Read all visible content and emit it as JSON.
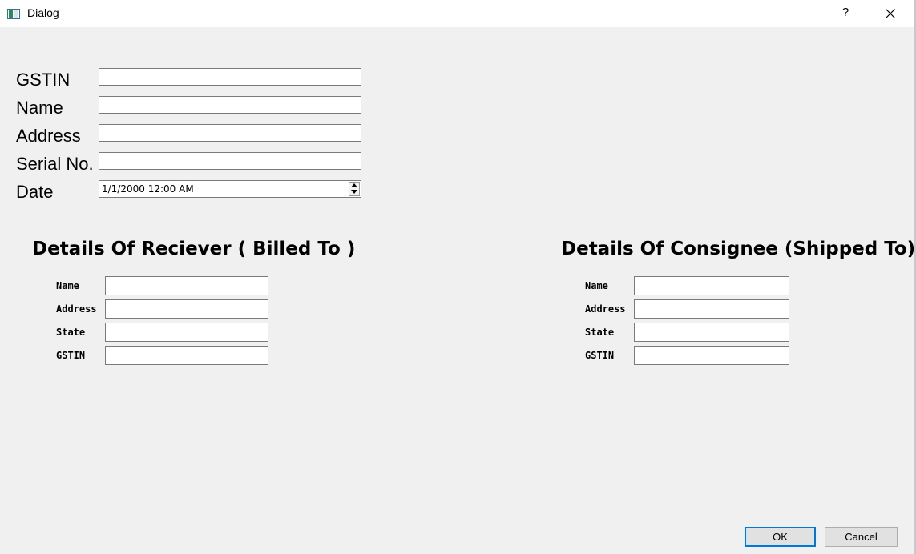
{
  "window": {
    "title": "Dialog",
    "help_label": "?"
  },
  "main_form": {
    "fields": [
      {
        "label": "GSTIN",
        "value": ""
      },
      {
        "label": "Name",
        "value": ""
      },
      {
        "label": "Address",
        "value": ""
      },
      {
        "label": "Serial No.",
        "value": ""
      }
    ],
    "date": {
      "label": "Date",
      "value": "1/1/2000 12:00 AM"
    }
  },
  "receiver": {
    "heading": "Details Of Reciever ( Billed To )",
    "fields": [
      {
        "label": "Name",
        "value": ""
      },
      {
        "label": "Address",
        "value": ""
      },
      {
        "label": "State",
        "value": ""
      },
      {
        "label": "GSTIN",
        "value": ""
      }
    ]
  },
  "consignee": {
    "heading": "Details Of Consignee (Shipped To)",
    "fields": [
      {
        "label": "Name",
        "value": ""
      },
      {
        "label": "Address",
        "value": ""
      },
      {
        "label": "State",
        "value": ""
      },
      {
        "label": "GSTIN",
        "value": ""
      }
    ]
  },
  "buttons": {
    "ok": "OK",
    "cancel": "Cancel"
  },
  "colors": {
    "focus_border": "#0078d7",
    "background": "#f0f0f0"
  }
}
